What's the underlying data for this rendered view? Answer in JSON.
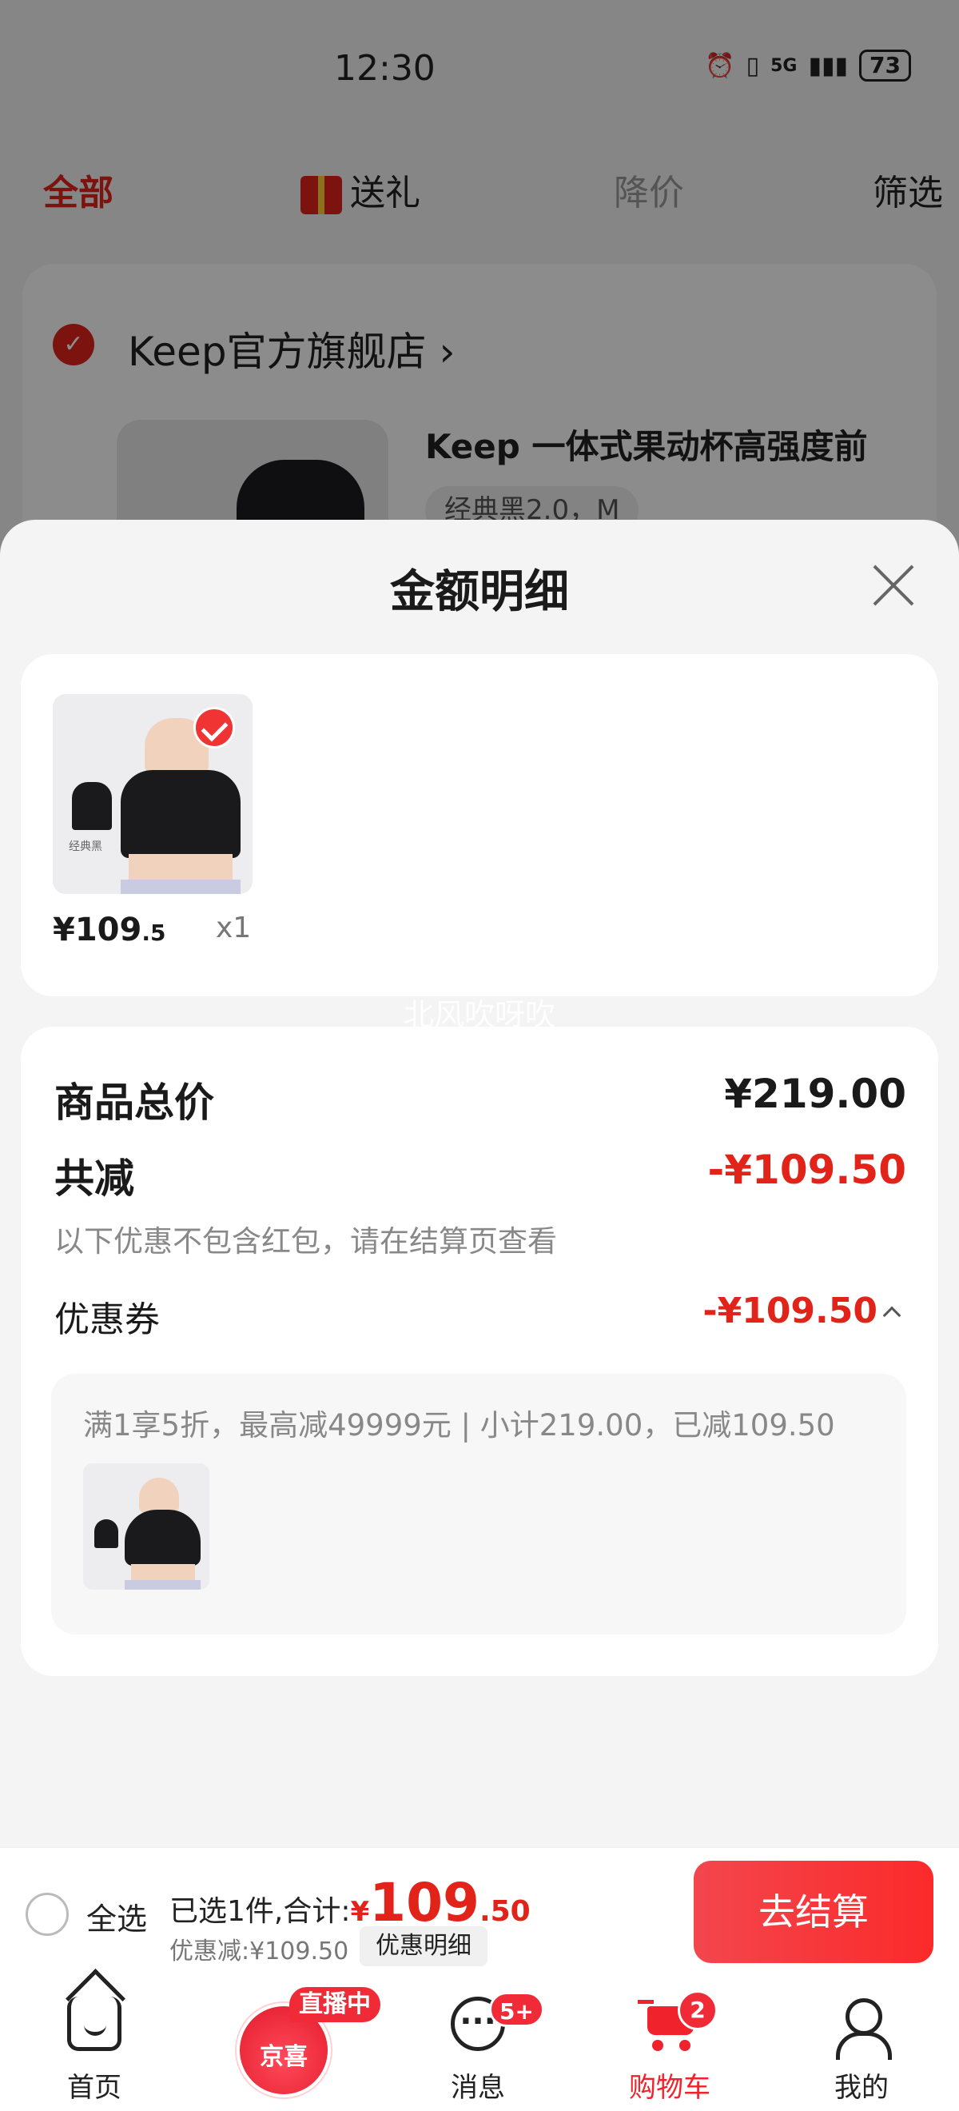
{
  "status_bar": {
    "time": "12:30",
    "network": "5G",
    "battery": "73"
  },
  "filter_tabs": [
    {
      "label": "全部"
    },
    {
      "label": "送礼"
    },
    {
      "label": "降价"
    },
    {
      "label": "筛选"
    }
  ],
  "store": {
    "name": "Keep官方旗舰店",
    "product_title": "Keep 一体式果动杯高强度前",
    "spec": "经典黑2.0，M"
  },
  "sheet": {
    "title": "金额明细",
    "item": {
      "price_int": "¥109",
      "price_dec": ".5",
      "qty": "x1",
      "thumb_caption": "经典黑"
    },
    "watermark": "北风吹呀吹",
    "total_label": "商品总价",
    "total_value": "¥219.00",
    "reduce_label": "共减",
    "reduce_value": "-¥109.50",
    "reduce_note": "以下优惠不包含红包，请在结算页查看",
    "coupon_label": "优惠券",
    "coupon_value": "-¥109.50",
    "coupon_desc": "满1享5折，最高减49999元 | 小计219.00，已减109.50"
  },
  "checkout": {
    "select_all": "全选",
    "summary_prefix": "已选1件,合计:",
    "currency": "¥",
    "amount_int": "109",
    "amount_dec": ".50",
    "discount": "优惠减:¥109.50",
    "detail_chip": "优惠明细",
    "button": "去结算"
  },
  "bottom_nav": {
    "home": "首页",
    "jx_logo": "京喜",
    "live_badge": "直播中",
    "messages": "消息",
    "messages_badge": "5+",
    "cart": "购物车",
    "cart_badge": "2",
    "me": "我的"
  },
  "colors": {
    "accent": "#e2231a",
    "button": "#fb2a2a"
  }
}
